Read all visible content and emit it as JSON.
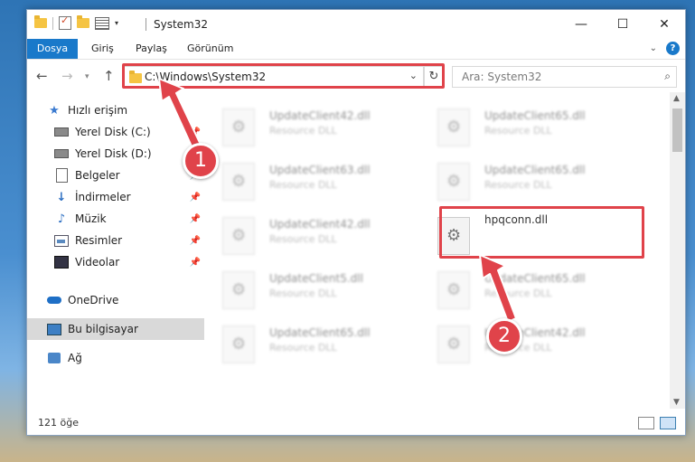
{
  "window": {
    "title": "System32"
  },
  "ribbon": {
    "tabs": [
      "Dosya",
      "Giriş",
      "Paylaş",
      "Görünüm"
    ]
  },
  "navigation": {
    "address": "C:\\Windows\\System32",
    "search_placeholder": "Ara: System32"
  },
  "sidebar": {
    "items": [
      {
        "label": "Hızlı erişim",
        "icon": "star-icon",
        "pinned": false
      },
      {
        "label": "Yerel Disk (C:)",
        "icon": "drive-icon",
        "pinned": true
      },
      {
        "label": "Yerel Disk (D:)",
        "icon": "drive-icon",
        "pinned": true
      },
      {
        "label": "Belgeler",
        "icon": "documents-icon",
        "pinned": true
      },
      {
        "label": "İndirmeler",
        "icon": "download-icon",
        "pinned": true
      },
      {
        "label": "Müzik",
        "icon": "music-icon",
        "pinned": true
      },
      {
        "label": "Resimler",
        "icon": "pictures-icon",
        "pinned": true
      },
      {
        "label": "Videolar",
        "icon": "videos-icon",
        "pinned": true
      },
      {
        "label": "OneDrive",
        "icon": "onedrive-icon",
        "pinned": false
      },
      {
        "label": "Bu bilgisayar",
        "icon": "this-pc-icon",
        "pinned": false
      },
      {
        "label": "Ağ",
        "icon": "network-icon",
        "pinned": false
      }
    ]
  },
  "files": {
    "col1": [
      {
        "name": "UpdateClient42.dll",
        "type": "Resource DLL"
      },
      {
        "name": "UpdateClient63.dll",
        "type": "Resource DLL"
      },
      {
        "name": "UpdateClient42.dll",
        "type": "Resource DLL"
      },
      {
        "name": "UpdateClient5.dll",
        "type": "Resource DLL"
      },
      {
        "name": "UpdateClient65.dll",
        "type": "Resource DLL"
      }
    ],
    "col2": [
      {
        "name": "UpdateClient65.dll",
        "type": "Resource DLL"
      },
      {
        "name": "UpdateClient65.dll",
        "type": "Resource DLL"
      },
      {
        "name": "hpqconn.dll",
        "type": ""
      },
      {
        "name": "UpdateClient65.dll",
        "type": "Resource DLL"
      },
      {
        "name": "UpdateClient42.dll",
        "type": "Resource DLL"
      }
    ]
  },
  "status": {
    "count": "121 öğe"
  },
  "callouts": {
    "step1": "1",
    "step2": "2"
  },
  "colors": {
    "accent": "#1979ca",
    "highlight": "#e0434a"
  }
}
